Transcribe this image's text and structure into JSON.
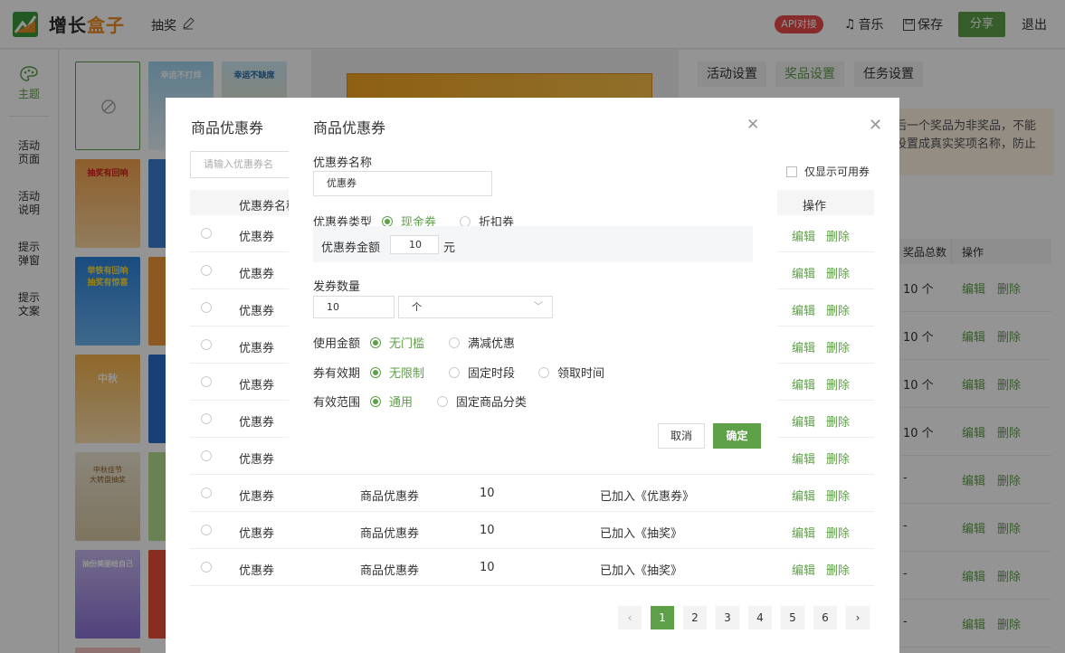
{
  "header": {
    "logo_text_a": "增长",
    "logo_text_b": "盒子",
    "page_name": "抽奖",
    "api_badge": "API对接",
    "music": "音乐",
    "save": "保存",
    "share": "分享",
    "logout": "退出"
  },
  "sidebar": {
    "theme": "主题",
    "items": [
      [
        "活动",
        "页面"
      ],
      [
        "活动",
        "说明"
      ],
      [
        "提示",
        "弹窗"
      ],
      [
        "提示",
        "文案"
      ]
    ]
  },
  "templates": {
    "thumb_texts": [
      "幸运不打烊",
      "幸运不缺席",
      "抽奖有回响",
      "举铁有回响",
      "抽奖有惊喜",
      "中秋",
      "中秋佳节",
      "大转盘抽奖",
      "抽份美丽给自己"
    ]
  },
  "right_panel": {
    "tabs": [
      "活动设置",
      "奖品设置",
      "任务设置"
    ],
    "notice_lines": [
      "后一个奖品为非奖品，不能",
      "设置成真实奖项名称，防止"
    ],
    "col_total": "奖品总数",
    "col_action": "操作",
    "rows": [
      {
        "total": "10 个",
        "edit": "编辑",
        "del": "删除"
      },
      {
        "total": "10 个",
        "edit": "编辑",
        "del": "删除"
      },
      {
        "total": "10 个",
        "edit": "编辑",
        "del": "删除"
      },
      {
        "total": "10 个",
        "edit": "编辑",
        "del": "删除"
      },
      {
        "total": "-",
        "edit": "编辑",
        "del": "删除"
      },
      {
        "total": "-",
        "edit": "编辑",
        "del": "删除"
      },
      {
        "total": "-",
        "edit": "编辑",
        "del": "删除"
      },
      {
        "total": "-",
        "edit": "编辑",
        "del": "删除"
      }
    ]
  },
  "list_dialog": {
    "title": "商品优惠券",
    "search_placeholder": "请输入优惠券名",
    "only_available": "仅显示可用券",
    "col_name": "优惠券名称",
    "col_action": "操作",
    "rows": [
      {
        "name": "优惠券",
        "type": "",
        "count": "",
        "status": "",
        "edit": "编辑",
        "del": "删除"
      },
      {
        "name": "优惠券",
        "type": "",
        "count": "",
        "status": "",
        "edit": "编辑",
        "del": "删除"
      },
      {
        "name": "优惠券",
        "type": "",
        "count": "",
        "status": "",
        "edit": "编辑",
        "del": "删除"
      },
      {
        "name": "优惠券",
        "type": "",
        "count": "",
        "status": "",
        "edit": "编辑",
        "del": "删除"
      },
      {
        "name": "优惠券",
        "type": "",
        "count": "",
        "status": "",
        "edit": "编辑",
        "del": "删除"
      },
      {
        "name": "优惠券",
        "type": "",
        "count": "",
        "status": "",
        "edit": "编辑",
        "del": "删除"
      },
      {
        "name": "优惠券",
        "type": "",
        "count": "",
        "status": "",
        "edit": "编辑",
        "del": "删除"
      },
      {
        "name": "优惠券",
        "type": "商品优惠券",
        "count": "10",
        "status": "已加入《优惠券》",
        "edit": "编辑",
        "del": "删除"
      },
      {
        "name": "优惠券",
        "type": "商品优惠券",
        "count": "10",
        "status": "已加入《抽奖》",
        "edit": "编辑",
        "del": "删除"
      },
      {
        "name": "优惠券",
        "type": "商品优惠券",
        "count": "10",
        "status": "已加入《抽奖》",
        "edit": "编辑",
        "del": "删除"
      }
    ],
    "pages": [
      "1",
      "2",
      "3",
      "4",
      "5",
      "6"
    ],
    "active_page": "1"
  },
  "modal": {
    "title": "商品优惠券",
    "name_label": "优惠券名称",
    "name_value": "优惠券",
    "type_label": "优惠券类型",
    "type_cash": "现金券",
    "type_discount": "折扣券",
    "amount_label": "优惠券金额",
    "amount_value": "10",
    "amount_unit": "元",
    "qty_label": "发券数量",
    "qty_value": "10",
    "qty_unit": "个",
    "use_label": "使用金额",
    "use_opt1": "无门槛",
    "use_opt2": "满减优惠",
    "valid_label": "券有效期",
    "valid_opt1": "无限制",
    "valid_opt2": "固定时段",
    "valid_opt3": "领取时间",
    "scope_label": "有效范围",
    "scope_opt1": "通用",
    "scope_opt2": "固定商品分类",
    "cancel": "取消",
    "ok": "确定"
  },
  "colors": {
    "accent": "#5ea048",
    "badge": "#e84a4a",
    "logo_orange": "#f08a24"
  }
}
